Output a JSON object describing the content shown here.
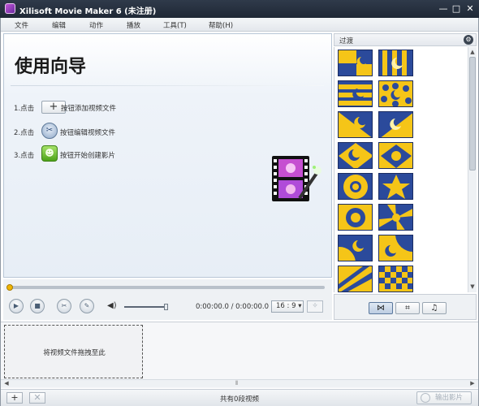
{
  "window": {
    "title": "Xilisoft Movie Maker 6 (未注册)",
    "minimize": "—",
    "maximize": "□",
    "close": "✕"
  },
  "menu": {
    "items": [
      {
        "label": "文件"
      },
      {
        "label": "编辑"
      },
      {
        "label": "动作"
      },
      {
        "label": "播放"
      },
      {
        "label": "工具(T)"
      },
      {
        "label": "帮助(H)"
      }
    ]
  },
  "wizard": {
    "title": "使用向导",
    "steps": [
      {
        "num": "1.点击",
        "desc": "按钮添加视频文件",
        "icon": "plus-icon",
        "glyph": "+"
      },
      {
        "num": "2.点击",
        "desc": "按钮编辑视频文件",
        "icon": "edit-icon",
        "glyph": "✂"
      },
      {
        "num": "3.点击",
        "desc": "按钮开始创建影片",
        "icon": "create-movie-icon",
        "glyph": "☻"
      }
    ]
  },
  "filter_panel": {
    "title": "过渡",
    "settings_icon": "gear-icon",
    "tabs": [
      {
        "icon": "transition-icon",
        "glyph": "⋈",
        "active": true
      },
      {
        "icon": "crop-icon",
        "glyph": "⌗",
        "active": false
      },
      {
        "icon": "music-icon",
        "glyph": "♫",
        "active": false
      }
    ]
  },
  "player": {
    "time": "0:00:00.0 / 0:00:00.0",
    "aspect_ratio": "16 : 9",
    "seek_progress": 0,
    "volume": 1.0
  },
  "clip_area": {
    "drop_hint": "将视频文件拖拽至此"
  },
  "statusbar": {
    "add": "+",
    "remove": "✕",
    "status": "共有0段视频",
    "convert": "输出影片"
  },
  "colors": {
    "accent": "#f0b400",
    "thumb_blue": "#2b4a9b",
    "thumb_yellow": "#f5c518"
  }
}
